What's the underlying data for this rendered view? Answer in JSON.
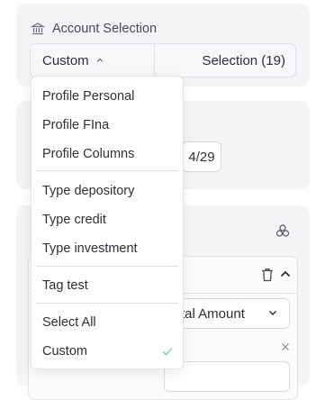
{
  "account_selection": {
    "title": "Account Selection",
    "mode_value": "Custom",
    "selection_label": "Selection (19)"
  },
  "date": {
    "value": "4/29"
  },
  "metric": {
    "selected": "tal Amount"
  },
  "dropdown": {
    "items": [
      {
        "label": "Profile Personal",
        "checked": false
      },
      {
        "label": "Profile FIna",
        "checked": false
      },
      {
        "label": "Profile Columns",
        "checked": false
      },
      {
        "label": "Type depository",
        "checked": false
      },
      {
        "label": "Type credit",
        "checked": false
      },
      {
        "label": "Type investment",
        "checked": false
      },
      {
        "label": "Tag test",
        "checked": false
      },
      {
        "label": "Select All",
        "checked": false
      },
      {
        "label": "Custom",
        "checked": true
      }
    ]
  },
  "colors": {
    "card_bg": "#f4f4f6",
    "border": "#e0e0e5",
    "text": "#2f2f35",
    "check_accent": "#7fd0a8"
  },
  "icons": [
    "bank-icon",
    "chevron-up-icon",
    "group-icon",
    "trash-icon",
    "chevron-down-icon",
    "close-icon",
    "check-icon"
  ]
}
